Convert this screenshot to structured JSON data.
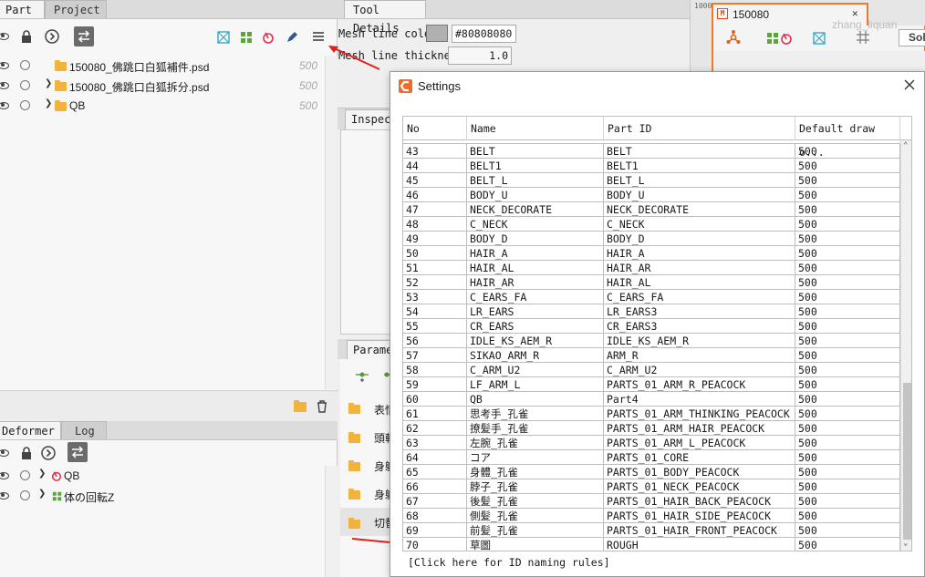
{
  "part_panel": {
    "tabs": [
      "Part",
      "Project"
    ],
    "rows": [
      {
        "name": "150080_佛跳口白狐補件.psd",
        "value": "500"
      },
      {
        "name": "150080_佛跳口白狐拆分.psd",
        "value": "500"
      },
      {
        "name": "QB",
        "value": "500"
      }
    ]
  },
  "deformer_panel": {
    "tabs": [
      "Deformer",
      "Log"
    ],
    "rows": [
      {
        "name": "QB"
      },
      {
        "name": "体の回転Z"
      }
    ]
  },
  "tool_details": {
    "tab": "Tool Details",
    "mesh_line_color_label": "Mesh line color",
    "mesh_line_color_value": "#80808080",
    "mesh_line_thickness_label": "Mesh line thickness",
    "mesh_line_thickness_value": "1.0",
    "inspector_tab": "Inspect",
    "parameter_tab": "Paramet",
    "param_items": [
      "表情",
      "頭転",
      "身躰",
      "身躰",
      "切替"
    ]
  },
  "canvas": {
    "tab_title": "150080",
    "tab_badge": "M",
    "ruler_value": "1000",
    "watermark": "zhang_liquan",
    "solo_button": "Sol"
  },
  "settings_dialog": {
    "title": "Settings",
    "columns": [
      "No",
      "Name",
      "Part ID",
      "Default draw o..."
    ],
    "rows": [
      [
        "43",
        "BELT",
        "BELT",
        "500"
      ],
      [
        "44",
        "BELT1",
        "BELT1",
        "500"
      ],
      [
        "45",
        "BELT_L",
        "BELT_L",
        "500"
      ],
      [
        "46",
        "BODY_U",
        "BODY_U",
        "500"
      ],
      [
        "47",
        "NECK_DECORATE",
        "NECK_DECORATE",
        "500"
      ],
      [
        "48",
        "C_NECK",
        "C_NECK",
        "500"
      ],
      [
        "49",
        "BODY_D",
        "BODY_D",
        "500"
      ],
      [
        "50",
        "HAIR_A",
        "HAIR_A",
        "500"
      ],
      [
        "51",
        "HAIR_AL",
        "HAIR_AR",
        "500"
      ],
      [
        "52",
        "HAIR_AR",
        "HAIR_AL",
        "500"
      ],
      [
        "53",
        "C_EARS_FA",
        "C_EARS_FA",
        "500"
      ],
      [
        "54",
        "LR_EARS",
        "LR_EARS3",
        "500"
      ],
      [
        "55",
        "CR_EARS",
        "CR_EARS3",
        "500"
      ],
      [
        "56",
        "IDLE_KS_AEM_R",
        "IDLE_KS_AEM_R",
        "500"
      ],
      [
        "57",
        "SIKAO_ARM_R",
        "ARM_R",
        "500"
      ],
      [
        "58",
        "C_ARM_U2",
        "C_ARM_U2",
        "500"
      ],
      [
        "59",
        "LF_ARM_L",
        "PARTS_01_ARM_R_PEACOCK",
        "500"
      ],
      [
        "60",
        "QB",
        "Part4",
        "500"
      ],
      [
        "61",
        "思考手_孔雀",
        "PARTS_01_ARM_THINKING_PEACOCK",
        "500"
      ],
      [
        "62",
        "撩髪手_孔雀",
        "PARTS_01_ARM_HAIR_PEACOCK",
        "500"
      ],
      [
        "63",
        "左腕_孔雀",
        "PARTS_01_ARM_L_PEACOCK",
        "500"
      ],
      [
        "64",
        "コア",
        "PARTS_01_CORE",
        "500"
      ],
      [
        "65",
        "身體_孔雀",
        "PARTS_01_BODY_PEACOCK",
        "500"
      ],
      [
        "66",
        "脖子_孔雀",
        "PARTS_01_NECK_PEACOCK",
        "500"
      ],
      [
        "67",
        "後髪_孔雀",
        "PARTS_01_HAIR_BACK_PEACOCK",
        "500"
      ],
      [
        "68",
        "側髪_孔雀",
        "PARTS_01_HAIR_SIDE_PEACOCK",
        "500"
      ],
      [
        "69",
        "前髪_孔雀",
        "PARTS_01_HAIR_FRONT_PEACOCK",
        "500"
      ],
      [
        "70",
        "草圖",
        "ROUGH",
        "500"
      ]
    ],
    "footer_link": "[Click here for ID naming rules]"
  }
}
